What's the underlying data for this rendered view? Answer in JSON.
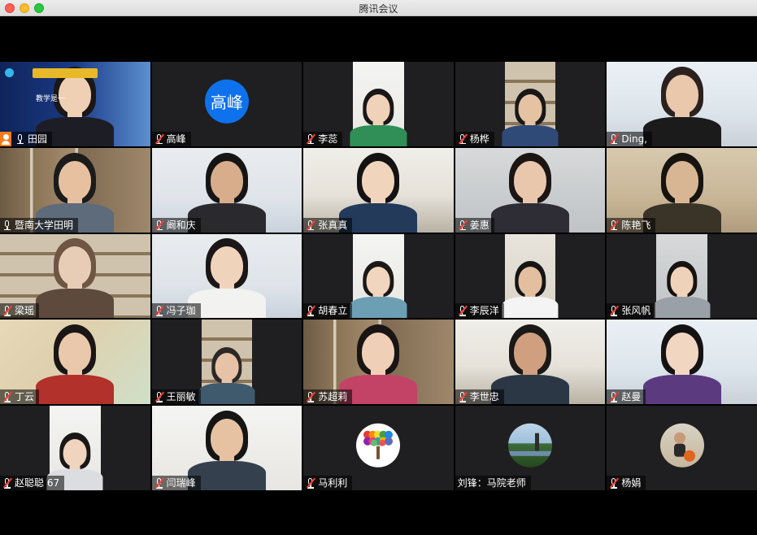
{
  "window": {
    "title": "腾讯会议"
  },
  "participants": [
    {
      "name": "田园",
      "kind": "video",
      "bg": "bg-slide",
      "host": true,
      "muted": false,
      "hair": "#1a1717",
      "shirt": "#1d1d26",
      "skin": "#efd0b4",
      "slide_title": "教学是一"
    },
    {
      "name": "高峰",
      "kind": "initial",
      "initial": "高峰",
      "muted": true
    },
    {
      "name": "李蕊",
      "kind": "video-inset",
      "bg": "bg-light",
      "muted": true,
      "hair": "#1a1717",
      "shirt": "#2f8f56",
      "skin": "#f0d2b8"
    },
    {
      "name": "杨桦",
      "kind": "video-inset",
      "bg": "bg-shelf2",
      "muted": true,
      "hair": "#1a1717",
      "shirt": "#304a78",
      "skin": "#e5c2a2"
    },
    {
      "name": "Ding,",
      "kind": "video",
      "bg": "bg-window",
      "muted": true,
      "hair": "#2b2220",
      "shirt": "#1b1b1b",
      "skin": "#e9c8ab"
    },
    {
      "name": "暨南大学田明",
      "kind": "video",
      "bg": "bg-shelf",
      "muted": false,
      "hair": "#1b1b1b",
      "shirt": "#5d6b7a",
      "skin": "#e6c09f"
    },
    {
      "name": "阚和庆",
      "kind": "video",
      "bg": "bg-office",
      "muted": true,
      "hair": "#161515",
      "shirt": "#2a2a2e",
      "skin": "#d8ad8b"
    },
    {
      "name": "张真真",
      "kind": "video",
      "bg": "bg-room",
      "muted": true,
      "hair": "#141212",
      "shirt": "#233a5b",
      "skin": "#f0d4bc"
    },
    {
      "name": "姜惠",
      "kind": "video",
      "bg": "bg-grey",
      "muted": true,
      "hair": "#1b1514",
      "shirt": "#2e2d35",
      "skin": "#e8c7ad"
    },
    {
      "name": "陈艳飞",
      "kind": "video",
      "bg": "bg-warm",
      "muted": true,
      "hair": "#17130f",
      "shirt": "#3a3327",
      "skin": "#d9b693"
    },
    {
      "name": "梁瑶",
      "kind": "video",
      "bg": "bg-shelf2",
      "muted": true,
      "hair": "#6f5644",
      "shirt": "#5d4a3c",
      "skin": "#e8cdb6"
    },
    {
      "name": "冯子珈",
      "kind": "video",
      "bg": "bg-office",
      "muted": true,
      "hair": "#1a1716",
      "shirt": "#f2f2f0",
      "skin": "#f0d3bb"
    },
    {
      "name": "胡春立",
      "kind": "video-inset",
      "bg": "bg-light",
      "muted": true,
      "hair": "#1b1817",
      "shirt": "#6c9fb4",
      "skin": "#f1d5be"
    },
    {
      "name": "李辰洋",
      "kind": "video-inset",
      "bg": "bg-stripe",
      "muted": true,
      "hair": "#161414",
      "shirt": "#f4f4f4",
      "skin": "#e3bf9f"
    },
    {
      "name": "张风帆",
      "kind": "video-inset",
      "bg": "bg-grey",
      "muted": true,
      "hair": "#15120f",
      "shirt": "#9aa0a7",
      "skin": "#efd2ba"
    },
    {
      "name": "丁云",
      "kind": "video",
      "bg": "bg-map",
      "muted": true,
      "hair": "#1a1616",
      "shirt": "#b2312b",
      "skin": "#e9c8ab"
    },
    {
      "name": "王丽敏",
      "kind": "video-inset",
      "bg": "bg-shelf2",
      "muted": true,
      "hair": "#2d2827",
      "shirt": "#3f5a6d",
      "skin": "#e6c3a6"
    },
    {
      "name": "苏超莉",
      "kind": "video",
      "bg": "bg-shelf",
      "muted": true,
      "hair": "#181514",
      "shirt": "#c24366",
      "skin": "#efd0b7"
    },
    {
      "name": "李世忠",
      "kind": "video",
      "bg": "bg-room",
      "muted": true,
      "hair": "#1a1918",
      "shirt": "#2b3745",
      "skin": "#cf9f7f"
    },
    {
      "name": "赵曼",
      "kind": "video",
      "bg": "bg-window",
      "muted": true,
      "hair": "#141213",
      "shirt": "#5b3a7f",
      "skin": "#f1d6c2"
    },
    {
      "name": "赵聪聪 67",
      "kind": "video-inset",
      "bg": "bg-light",
      "muted": true,
      "hair": "#1a1717",
      "shirt": "#dbdde0",
      "skin": "#f0d4bd"
    },
    {
      "name": "闫瑞峰",
      "kind": "video",
      "bg": "bg-light",
      "muted": true,
      "hair": "#161515",
      "shirt": "#34404d",
      "skin": "#e6c2a3"
    },
    {
      "name": "马利利",
      "kind": "picture",
      "pic": "tree",
      "muted": true
    },
    {
      "name": "刘锋：马院老师",
      "kind": "picture",
      "pic": "landscape",
      "muted": false,
      "nomic": true
    },
    {
      "name": "杨娟",
      "kind": "picture",
      "pic": "kid",
      "muted": true
    }
  ]
}
